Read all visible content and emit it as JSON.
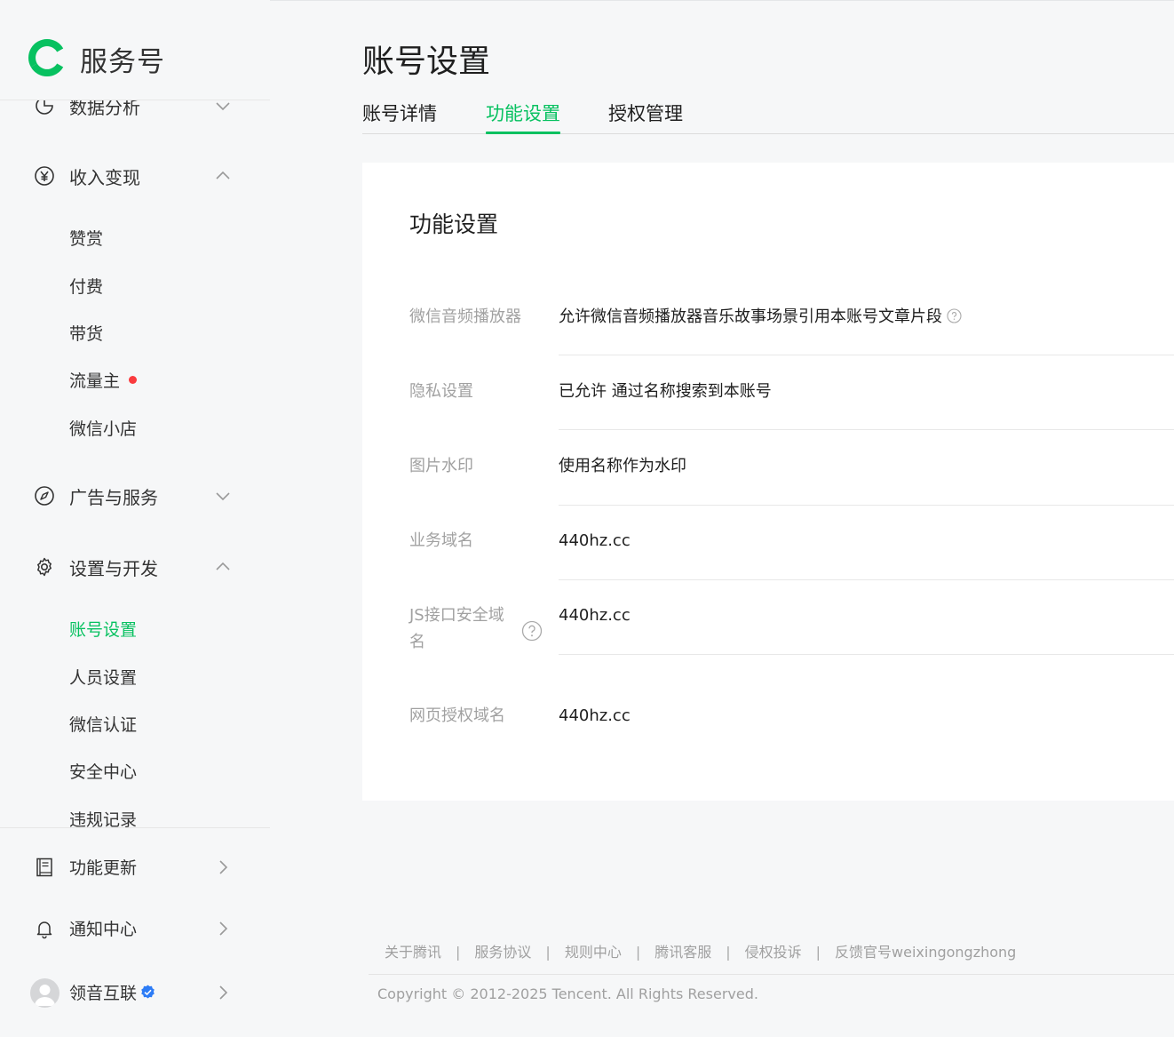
{
  "brand": {
    "name": "服务号("
  },
  "page": {
    "title": "账号设置"
  },
  "sidebar": {
    "sections": [
      {
        "label": "数据分析",
        "icon": "chart-pie-icon",
        "expanded": false
      },
      {
        "label": "收入变现",
        "icon": "yen-circle-icon",
        "expanded": true,
        "items": [
          "赞赏",
          "付费",
          "带货",
          "流量主",
          "微信小店"
        ]
      },
      {
        "label": "广告与服务",
        "icon": "compass-icon",
        "expanded": false
      },
      {
        "label": "设置与开发",
        "icon": "gear-icon",
        "expanded": true,
        "items": [
          "账号设置",
          "人员设置",
          "微信认证",
          "安全中心",
          "违规记录"
        ]
      }
    ],
    "bottom": [
      {
        "label": "功能更新",
        "icon": "book-icon"
      },
      {
        "label": "通知中心",
        "icon": "bell-icon"
      },
      {
        "label": "领音互联",
        "icon": "avatar",
        "verified": true
      }
    ],
    "active_item": "账号设置",
    "badge_item": "流量主"
  },
  "tabs": [
    "账号详情",
    "功能设置",
    "授权管理"
  ],
  "active_tab": "功能设置",
  "card": {
    "title": "功能设置",
    "rows": [
      {
        "label": "微信音频播放器",
        "value": "允许微信音频播放器音乐故事场景引用本账号文章片段"
      },
      {
        "label": "隐私设置",
        "value": "已允许 通过名称搜索到本账号"
      },
      {
        "label": "图片水印",
        "value": "使用名称作为水印"
      },
      {
        "label": "业务域名",
        "value": "440hz.cc"
      },
      {
        "label": "JS接口安全域名",
        "value": "440hz.cc"
      },
      {
        "label": "网页授权域名",
        "value": "440hz.cc"
      }
    ]
  },
  "footer": {
    "links": [
      "关于腾讯",
      "服务协议",
      "规则中心",
      "腾讯客服",
      "侵权投诉",
      "反馈官号weixingongzhong"
    ],
    "separator": "|",
    "copyright": "Copyright © 2012-2025 Tencent. All Rights Reserved."
  },
  "colors": {
    "accent": "#07c160",
    "badge": "#fa3b3e",
    "verified": "#2d7cf6"
  }
}
